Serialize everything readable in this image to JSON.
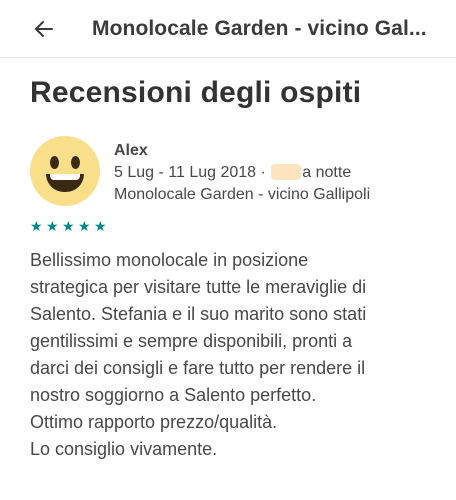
{
  "header": {
    "title": "Monolocale Garden - vicino Gal..."
  },
  "page": {
    "title": "Recensioni degli ospiti"
  },
  "review": {
    "author": "Alex",
    "date_range": "5 Lug - 11 Lug 2018 ·",
    "night_suffix": "a notte",
    "listing": "Monolocale Garden - vicino Gallipoli",
    "rating": 5,
    "text_lines": [
      "Bellissimo monolocale in posizione",
      "strategica per visitare tutte le meraviglie di",
      "Salento. Stefania e il suo marito sono stati",
      "gentilissimi e sempre disponibili, pronti a",
      "darci dei consigli e fare tutto per rendere il",
      "nostro soggiorno a Salento perfetto.",
      "Ottimo rapporto prezzo/qualità.",
      "Lo consiglio vivamente."
    ]
  },
  "colors": {
    "star": "#00838a",
    "avatar_bg": "#fadf8b"
  }
}
